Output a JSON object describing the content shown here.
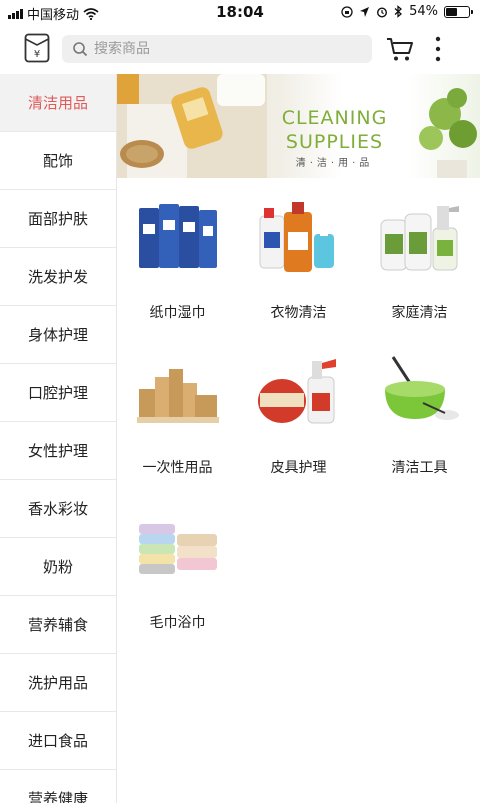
{
  "status_bar": {
    "carrier": "中国移动",
    "time": "18:04",
    "battery": "54%",
    "battery_level": 0.54
  },
  "header": {
    "search_placeholder": "搜索商品",
    "icons": [
      "store-logo-icon",
      "search-icon",
      "cart-icon",
      "more-vertical-icon"
    ]
  },
  "sidebar": {
    "items": [
      {
        "label": "清洁用品",
        "active": true
      },
      {
        "label": "配饰"
      },
      {
        "label": "面部护肤"
      },
      {
        "label": "洗发护发"
      },
      {
        "label": "身体护理"
      },
      {
        "label": "口腔护理"
      },
      {
        "label": "女性护理"
      },
      {
        "label": "香水彩妆"
      },
      {
        "label": "奶粉"
      },
      {
        "label": "营养辅食"
      },
      {
        "label": "洗护用品"
      },
      {
        "label": "进口食品"
      },
      {
        "label": "营养健康"
      }
    ]
  },
  "banner": {
    "title_line1": "CLEANING",
    "title_line2": "SUPPLIES",
    "subtitle": "清·洁·用·品"
  },
  "categories": [
    {
      "label": "纸巾湿巾"
    },
    {
      "label": "衣物清洁"
    },
    {
      "label": "家庭清洁"
    },
    {
      "label": "一次性用品"
    },
    {
      "label": "皮具护理"
    },
    {
      "label": "清洁工具"
    },
    {
      "label": "毛巾浴巾"
    }
  ],
  "colors": {
    "active_text": "#e05a5a",
    "banner_green": "#7fae3a"
  }
}
